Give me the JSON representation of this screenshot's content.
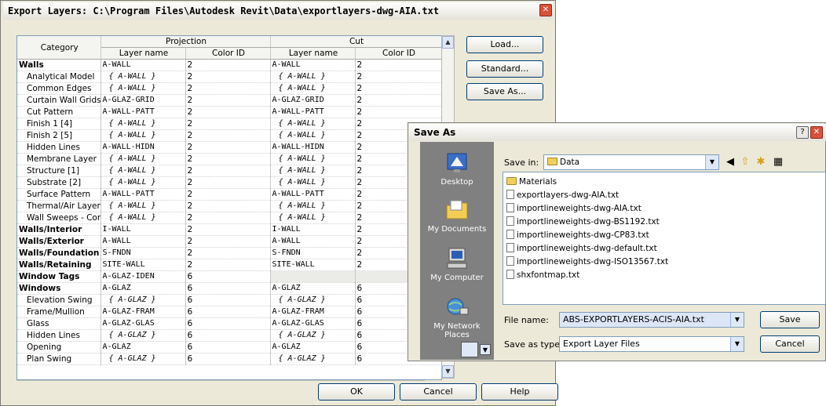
{
  "export_dialog": {
    "title": "Export Layers: C:\\Program Files\\Autodesk Revit\\Data\\exportlayers-dwg-AIA.txt",
    "headers": {
      "category": "Category",
      "projection": "Projection",
      "cut": "Cut",
      "layer_name": "Layer name",
      "color_id": "Color ID"
    },
    "rows": [
      {
        "cat": "Walls",
        "level": "top",
        "p_layer": "A-WALL",
        "p_color": "2",
        "c_layer": "A-WALL",
        "c_color": "2"
      },
      {
        "cat": "Analytical Model",
        "level": "sub",
        "p_layer": "{ A-WALL }",
        "p_color": "2",
        "c_layer": "{ A-WALL }",
        "c_color": "2"
      },
      {
        "cat": "Common Edges",
        "level": "sub",
        "p_layer": "{ A-WALL }",
        "p_color": "2",
        "c_layer": "{ A-WALL }",
        "c_color": "2"
      },
      {
        "cat": "Curtain Wall Grids",
        "level": "sub",
        "p_layer": "A-GLAZ-GRID",
        "p_color": "2",
        "c_layer": "A-GLAZ-GRID",
        "c_color": "2"
      },
      {
        "cat": "Cut Pattern",
        "level": "sub",
        "p_layer": "A-WALL-PATT",
        "p_color": "2",
        "c_layer": "A-WALL-PATT",
        "c_color": "2"
      },
      {
        "cat": "Finish 1 [4]",
        "level": "sub",
        "p_layer": "{ A-WALL }",
        "p_color": "2",
        "c_layer": "{ A-WALL }",
        "c_color": "2"
      },
      {
        "cat": "Finish 2 [5]",
        "level": "sub",
        "p_layer": "{ A-WALL }",
        "p_color": "2",
        "c_layer": "{ A-WALL }",
        "c_color": "2"
      },
      {
        "cat": "Hidden Lines",
        "level": "sub",
        "p_layer": "A-WALL-HIDN",
        "p_color": "2",
        "c_layer": "A-WALL-HIDN",
        "c_color": "2"
      },
      {
        "cat": "Membrane Layer",
        "level": "sub",
        "p_layer": "{ A-WALL }",
        "p_color": "2",
        "c_layer": "{ A-WALL }",
        "c_color": "2"
      },
      {
        "cat": "Structure [1]",
        "level": "sub",
        "p_layer": "{ A-WALL }",
        "p_color": "2",
        "c_layer": "{ A-WALL }",
        "c_color": "2"
      },
      {
        "cat": "Substrate [2]",
        "level": "sub",
        "p_layer": "{ A-WALL }",
        "p_color": "2",
        "c_layer": "{ A-WALL }",
        "c_color": "2"
      },
      {
        "cat": "Surface Pattern",
        "level": "sub",
        "p_layer": "A-WALL-PATT",
        "p_color": "2",
        "c_layer": "A-WALL-PATT",
        "c_color": "2"
      },
      {
        "cat": "Thermal/Air Layer [",
        "level": "sub",
        "p_layer": "{ A-WALL }",
        "p_color": "2",
        "c_layer": "{ A-WALL }",
        "c_color": "2"
      },
      {
        "cat": "Wall Sweeps - Corn",
        "level": "sub",
        "p_layer": "{ A-WALL }",
        "p_color": "2",
        "c_layer": "{ A-WALL }",
        "c_color": "2"
      },
      {
        "cat": "Walls/Interior",
        "level": "top",
        "p_layer": "I-WALL",
        "p_color": "2",
        "c_layer": "I-WALL",
        "c_color": "2"
      },
      {
        "cat": "Walls/Exterior",
        "level": "top",
        "p_layer": "A-WALL",
        "p_color": "2",
        "c_layer": "A-WALL",
        "c_color": "2"
      },
      {
        "cat": "Walls/Foundation",
        "level": "top",
        "p_layer": "S-FNDN",
        "p_color": "2",
        "c_layer": "S-FNDN",
        "c_color": "2"
      },
      {
        "cat": "Walls/Retaining",
        "level": "top",
        "p_layer": "SITE-WALL",
        "p_color": "2",
        "c_layer": "SITE-WALL",
        "c_color": "2"
      },
      {
        "cat": "Window Tags",
        "level": "top",
        "p_layer": "A-GLAZ-IDEN",
        "p_color": "6",
        "c_layer": "",
        "c_color": ""
      },
      {
        "cat": "Windows",
        "level": "top",
        "p_layer": "A-GLAZ",
        "p_color": "6",
        "c_layer": "A-GLAZ",
        "c_color": "6"
      },
      {
        "cat": "Elevation Swing",
        "level": "sub",
        "p_layer": "{ A-GLAZ }",
        "p_color": "6",
        "c_layer": "{ A-GLAZ }",
        "c_color": "6"
      },
      {
        "cat": "Frame/Mullion",
        "level": "sub",
        "p_layer": "A-GLAZ-FRAM",
        "p_color": "6",
        "c_layer": "A-GLAZ-FRAM",
        "c_color": "6"
      },
      {
        "cat": "Glass",
        "level": "sub",
        "p_layer": "A-GLAZ-GLAS",
        "p_color": "6",
        "c_layer": "A-GLAZ-GLAS",
        "c_color": "6"
      },
      {
        "cat": "Hidden Lines",
        "level": "sub",
        "p_layer": "{ A-GLAZ }",
        "p_color": "6",
        "c_layer": "{ A-GLAZ }",
        "c_color": "6"
      },
      {
        "cat": "Opening",
        "level": "sub",
        "p_layer": "A-GLAZ",
        "p_color": "6",
        "c_layer": "A-GLAZ",
        "c_color": "6"
      },
      {
        "cat": "Plan Swing",
        "level": "sub",
        "p_layer": "{ A-GLAZ }",
        "p_color": "6",
        "c_layer": "{ A-GLAZ }",
        "c_color": "6"
      }
    ],
    "buttons": {
      "load": "Load...",
      "standard": "Standard...",
      "save_as": "Save As...",
      "ok": "OK",
      "cancel": "Cancel",
      "help": "Help"
    }
  },
  "save_dialog": {
    "title": "Save As",
    "help_glyph": "?",
    "save_in_label": "Save in:",
    "save_in_value": "Data",
    "places": [
      {
        "label": "Desktop",
        "icon": "desktop-icon"
      },
      {
        "label": "My Documents",
        "icon": "my-documents-icon"
      },
      {
        "label": "My Computer",
        "icon": "my-computer-icon"
      },
      {
        "label": "My Network Places",
        "icon": "network-places-icon"
      }
    ],
    "files": [
      {
        "name": "Materials",
        "type": "folder"
      },
      {
        "name": "exportlayers-dwg-AIA.txt",
        "type": "file"
      },
      {
        "name": "importlineweights-dwg-AIA.txt",
        "type": "file"
      },
      {
        "name": "importlineweights-dwg-BS1192.txt",
        "type": "file"
      },
      {
        "name": "importlineweights-dwg-CP83.txt",
        "type": "file"
      },
      {
        "name": "importlineweights-dwg-default.txt",
        "type": "file"
      },
      {
        "name": "importlineweights-dwg-ISO13567.txt",
        "type": "file"
      },
      {
        "name": "shxfontmap.txt",
        "type": "file"
      }
    ],
    "file_name_label": "File name:",
    "file_name_value": "ABS-EXPORTLAYERS-ACIS-AIA.txt",
    "save_as_type_label": "Save as type:",
    "save_as_type_value": "Export Layer Files",
    "save_button": "Save",
    "cancel_button": "Cancel"
  },
  "colors": {
    "dialog_bg": "#ece9d8",
    "places_bar": "#808080",
    "close_red": "#d9513a",
    "grid_border": "#7f9db9"
  }
}
